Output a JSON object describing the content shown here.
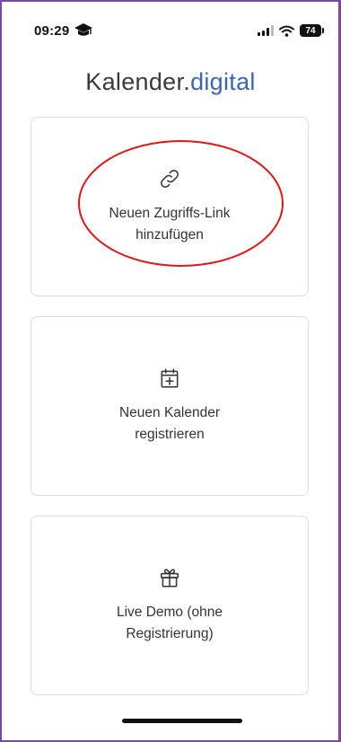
{
  "status_bar": {
    "time": "09:29",
    "battery_level": "74",
    "icons": [
      "graduation-cap-icon",
      "cellular-signal-icon",
      "wifi-icon",
      "battery-icon"
    ]
  },
  "header": {
    "title_main": "Kalender.",
    "title_accent": "digital",
    "accent_color": "#3a66b4"
  },
  "cards": [
    {
      "icon": "link-icon",
      "label": "Neuen Zugriffs-Link\nhinzufügen"
    },
    {
      "icon": "calendar-plus-icon",
      "label": "Neuen Kalender\nregistrieren"
    },
    {
      "icon": "gift-icon",
      "label": "Live Demo (ohne\nRegistrierung)"
    }
  ],
  "annotation": {
    "highlight_color": "#e01515"
  }
}
